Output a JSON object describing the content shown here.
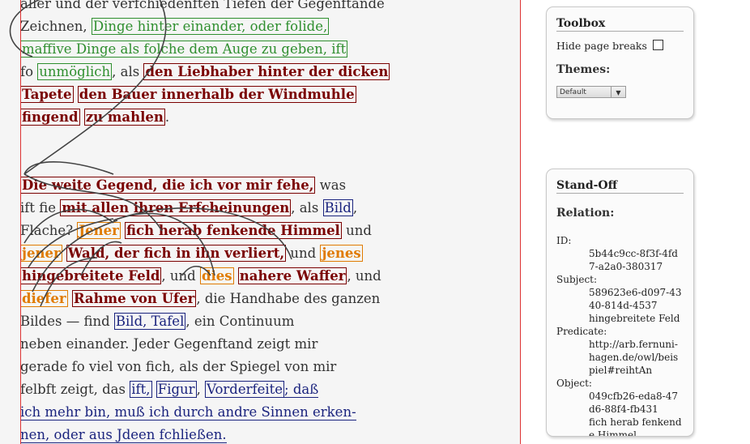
{
  "document": {
    "lines": [
      {
        "segments": [
          {
            "t": "aller und der verfchiedenften Tiefen der Gegenftande",
            "c": "plain"
          }
        ]
      },
      {
        "segments": [
          {
            "t": "Zeichnen, ",
            "c": "plain"
          },
          {
            "t": "Dinge hinter einander, oder folide,",
            "c": "g"
          }
        ]
      },
      {
        "segments": [
          {
            "t": "maffive Dinge als folche dem Auge zu geben, ift",
            "c": "g"
          }
        ]
      },
      {
        "segments": [
          {
            "t": "fo ",
            "c": "plain"
          },
          {
            "t": "unmöglich",
            "c": "g"
          },
          {
            "t": ", als ",
            "c": "plain"
          },
          {
            "t": "den Liebhaber hinter der dicken",
            "c": "r"
          }
        ]
      },
      {
        "segments": [
          {
            "t": "Tapete",
            "c": "r"
          },
          {
            "t": " ",
            "c": "plain"
          },
          {
            "t": "den Bauer innerhalb der Windmuhle",
            "c": "r"
          }
        ]
      },
      {
        "segments": [
          {
            "t": "fingend",
            "c": "r"
          },
          {
            "t": " ",
            "c": "plain"
          },
          {
            "t": "zu mahlen",
            "c": "r"
          },
          {
            "t": ".",
            "c": "plain"
          }
        ]
      },
      {
        "segments": []
      },
      {
        "segments": []
      },
      {
        "segments": [
          {
            "t": "Die weite Gegend, die ich vor mir fehe,",
            "c": "r"
          },
          {
            "t": " was",
            "c": "plain"
          }
        ]
      },
      {
        "segments": [
          {
            "t": "ift fie ",
            "c": "plain"
          },
          {
            "t": "mit allen ihren Erfcheinungen",
            "c": "r"
          },
          {
            "t": ", als ",
            "c": "plain"
          },
          {
            "t": "Bild",
            "c": "b"
          },
          {
            "t": ",",
            "c": "plain"
          }
        ]
      },
      {
        "segments": [
          {
            "t": "Flache? ",
            "c": "plain"
          },
          {
            "t": "Jener",
            "c": "o"
          },
          {
            "t": " ",
            "c": "plain"
          },
          {
            "t": "fich herab fenkende Himmel",
            "c": "r"
          },
          {
            "t": " und",
            "c": "plain"
          }
        ]
      },
      {
        "segments": [
          {
            "t": "jener",
            "c": "o"
          },
          {
            "t": " ",
            "c": "plain"
          },
          {
            "t": "Wald, der fich in ihn verliert,",
            "c": "r"
          },
          {
            "t": " und ",
            "c": "plain"
          },
          {
            "t": "jenes",
            "c": "o"
          }
        ]
      },
      {
        "segments": [
          {
            "t": "hingebreitete Feld",
            "c": "r"
          },
          {
            "t": ", und ",
            "c": "plain"
          },
          {
            "t": "dies",
            "c": "o"
          },
          {
            "t": " ",
            "c": "plain"
          },
          {
            "t": "nahere Waffer",
            "c": "r"
          },
          {
            "t": ", und",
            "c": "plain"
          }
        ]
      },
      {
        "segments": [
          {
            "t": "diefer",
            "c": "o"
          },
          {
            "t": " ",
            "c": "plain"
          },
          {
            "t": "Rahme von Ufer",
            "c": "r"
          },
          {
            "t": ", die Handhabe des ganzen",
            "c": "plain"
          }
        ]
      },
      {
        "segments": [
          {
            "t": "Bildes — find ",
            "c": "plain"
          },
          {
            "t": "Bild, Tafel",
            "c": "b"
          },
          {
            "t": ", ein Continuum",
            "c": "plain"
          }
        ]
      },
      {
        "segments": [
          {
            "t": "neben einander. Jeder Gegenftand zeigt mir",
            "c": "plain"
          }
        ]
      },
      {
        "segments": [
          {
            "t": "gerade fo viel von fich, als der Spiegel von mir",
            "c": "plain"
          }
        ]
      },
      {
        "segments": [
          {
            "t": "felbft zeigt, das ",
            "c": "plain"
          },
          {
            "t": "ift,",
            "c": "b"
          },
          {
            "t": " ",
            "c": "plain"
          },
          {
            "t": "Figur",
            "c": "b"
          },
          {
            "t": ", ",
            "c": "plain"
          },
          {
            "t": "Vorderfeite",
            "c": "b"
          },
          {
            "t": "; daß",
            "c": "ul"
          }
        ]
      },
      {
        "segments": [
          {
            "t": "ich mehr bin, muß ich durch andre Sinnen erken-",
            "c": "ul"
          }
        ]
      },
      {
        "segments": [
          {
            "t": "nen, oder aus Jdeen fchließen.",
            "c": "ul"
          }
        ]
      }
    ]
  },
  "toolbox": {
    "title": "Toolbox",
    "hide_page_breaks_label": "Hide page breaks",
    "themes_label": "Themes:",
    "theme_selected": "Default"
  },
  "standoff": {
    "title": "Stand-Off",
    "relation_label": "Relation:",
    "id_label": "ID:",
    "id_value": "5b44c9cc-8f3f-4fd7-a2a0-380317",
    "subject_label": "Subject:",
    "subject_value": "589623e6-d097-4340-814d-4537",
    "subject_text": "hingebreitete Feld",
    "predicate_label": "Predicate:",
    "predicate_value": "http://arb.fernuni-hagen.de/owl/beispiel#reihtAn",
    "object_label": "Object:",
    "object_value": "049cfb26-eda8-47d6-88f4-fb431",
    "object_text": "fich herab fenkende Himmel"
  }
}
